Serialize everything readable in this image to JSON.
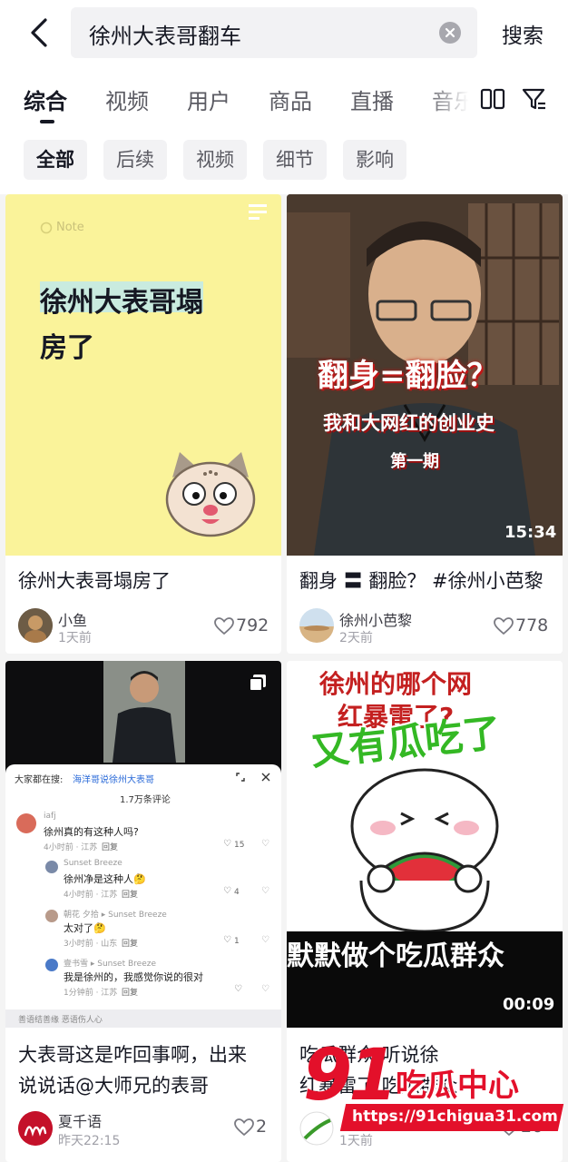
{
  "search": {
    "query": "徐州大表哥翻车",
    "button_label": "搜索"
  },
  "tabs": [
    {
      "label": "综合",
      "active": true
    },
    {
      "label": "视频"
    },
    {
      "label": "用户"
    },
    {
      "label": "商品"
    },
    {
      "label": "直播"
    },
    {
      "label": "音乐"
    }
  ],
  "chips": [
    {
      "label": "全部",
      "active": true
    },
    {
      "label": "后续"
    },
    {
      "label": "视频"
    },
    {
      "label": "细节"
    },
    {
      "label": "影响"
    }
  ],
  "cards": [
    {
      "thumb": {
        "note_label": "Note",
        "headline_line1": "徐州大表哥塌",
        "headline_line2": "房了"
      },
      "title": "徐州大表哥塌房了",
      "author": "小鱼",
      "time": "1天前",
      "likes": "792"
    },
    {
      "thumb": {
        "headline": "翻身=翻脸？",
        "sub": "我和大网红的创业史",
        "episode": "第一期",
        "duration": "15:34"
      },
      "title": "翻身 〓 翻脸？ #徐州小芭黎",
      "author": "徐州小芭黎",
      "time": "2天前",
      "likes": "778"
    },
    {
      "thumb": {
        "search_prefix": "大家都在搜:",
        "search_link": "海洋哥说徐州大表哥",
        "comment_count": "1.7万条评论",
        "comments": [
          {
            "name": "iafj",
            "text": "徐州真的有这种人吗?",
            "meta": "4小时前 · 江苏",
            "reply": "回复",
            "likes": "15"
          },
          {
            "name": "Sunset Breeze",
            "text": "徐州净是这种人🤔",
            "meta": "4小时前 · 江苏",
            "reply": "回复",
            "likes": "4"
          },
          {
            "name": "朝花 夕拾 ▸ Sunset Breeze",
            "text": "太对了🤔",
            "meta": "3小时前 · 山东",
            "reply": "回复",
            "likes": "1"
          },
          {
            "name": "壹书雪 ▸ Sunset Breeze",
            "text": "我是徐州的，我感觉你说的很对",
            "meta": "1分钟前 · 江苏",
            "reply": "回复",
            "likes": ""
          }
        ],
        "input_hint": "善语结善缘  恶语伤人心"
      },
      "title_line1": "大表哥这是咋回事啊，出来",
      "title_line2": "说说话@大师兄的表哥",
      "author": "夏千语",
      "time": "昨天22:15",
      "likes": "2"
    },
    {
      "thumb": {
        "top_line1": "徐州的哪个网",
        "top_line2": "红暴雷了?",
        "overlay": "又有瓜吃了",
        "bottom": "默默做个吃瓜群众",
        "duration": "00:09"
      },
      "title_line1": "吃瓜群众 听说徐",
      "title_line2": "红暴雷了 吃瓜群众",
      "author": "",
      "time": "1天前",
      "likes": "26"
    }
  ],
  "watermark": {
    "logo": "91",
    "name": "吃瓜中心",
    "url": "https://91chigua31.com"
  }
}
